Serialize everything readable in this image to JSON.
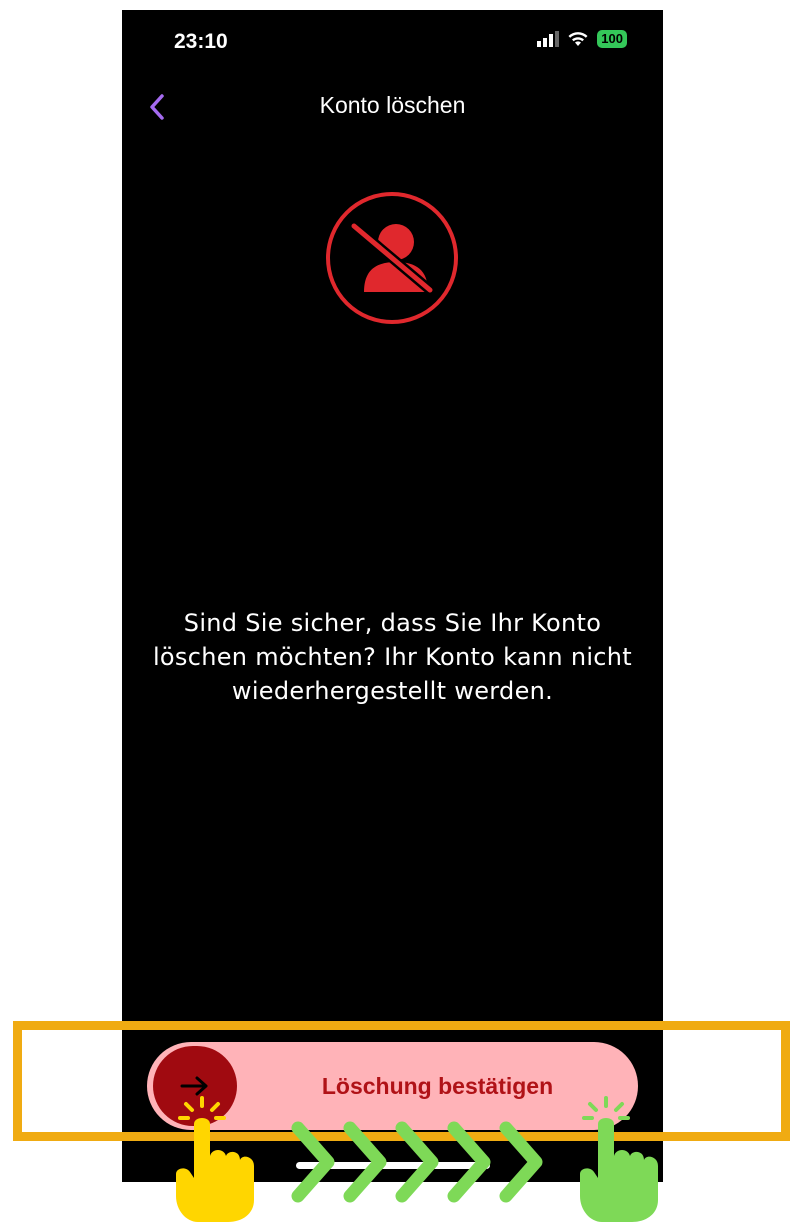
{
  "status_bar": {
    "time": "23:10",
    "battery": "100"
  },
  "nav": {
    "title": "Konto löschen"
  },
  "main": {
    "message": "Sind Sie sicher, dass Sie Ihr Konto löschen möchten? Ihr Konto kann nicht wiederhergestellt werden."
  },
  "slider": {
    "label": "Löschung bestätigen"
  },
  "colors": {
    "accent_purple": "#a56bf0",
    "danger_red": "#e0282d",
    "slider_bg": "#ffb3b8",
    "knob": "#a00a10",
    "highlight": "#f0ab12",
    "hand_start": "#ffd600",
    "hand_end": "#7ed957"
  },
  "icons": [
    "back-chevron-icon",
    "signal-icon",
    "wifi-icon",
    "battery-icon",
    "user-deleted-icon",
    "arrow-right-icon",
    "tap-hand-icon",
    "swipe-chevrons-icon"
  ]
}
